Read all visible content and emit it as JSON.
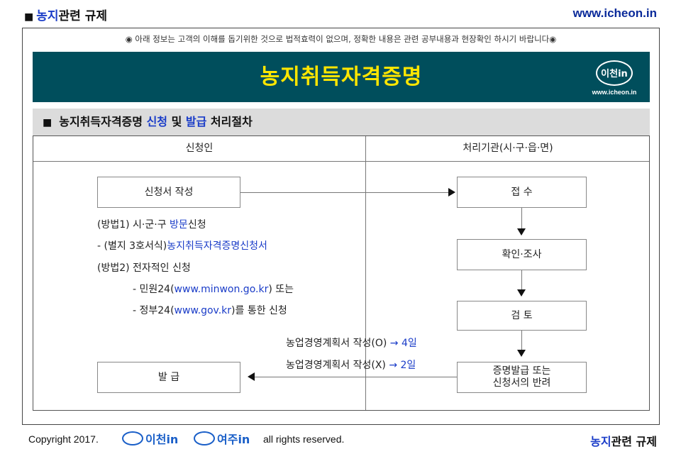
{
  "header": {
    "title_prefix": "■",
    "title_blue": "농지",
    "title_rest": "관련 규제",
    "url": "www.icheon.in"
  },
  "notice": "◉ 아래 정보는 고객의 이해를 돕기위한 것으로 법적효력이 없으며, 정확한 내용은 관련 공부내용과 현장확인 하시기 바랍니다◉",
  "banner": {
    "title": "농지취득자격증명",
    "logo_text": "이천in",
    "logo_url": "www.icheon.in",
    "bg_color": "#004e5c",
    "title_color": "#ffe600"
  },
  "section": {
    "bullet": "■",
    "part1": "농지취득자격증명 ",
    "part2": "신청",
    "part3": " 및 ",
    "part4": "발급",
    "part5": " 처리절차"
  },
  "table": {
    "col_left": "신청인",
    "col_right": "처리기관(시·구·읍·면)"
  },
  "flow": {
    "apply_box": "신청서 작성",
    "receive_box": "접  수",
    "check_box": "확인·조사",
    "review_box": "검  토",
    "issue_result_line1": "증명발급 또는",
    "issue_result_line2": "신청서의 반려",
    "issue_box": "발  급"
  },
  "methods": {
    "m1_prefix": "(방법1) 시·군·구 ",
    "m1_blue": "방문",
    "m1_suffix": "신청",
    "m1_sub_prefix": " - (별지 3호서식)",
    "m1_sub_blue": "농지취득자격증명신청서",
    "m2": "(방법2) 전자적인 신청",
    "m2_a_prefix": "- 민원24(",
    "m2_a_blue": "www.minwon.go.kr",
    "m2_a_suffix": ") 또는",
    "m2_b_prefix": "- 정부24(",
    "m2_b_blue": "www.gov.kr",
    "m2_b_suffix": ")를 통한 신청"
  },
  "durations": {
    "d1_prefix": "농업경영계획서 작성(O) ",
    "d1_blue": "→ 4일",
    "d2_prefix": "농업경영계획서 작성(X) ",
    "d2_blue": "→ 2일"
  },
  "footer": {
    "copyright": "Copyright 2017.",
    "logo1": "이천in",
    "logo2": "여주in",
    "rights": "all rights reserved.",
    "right_blue": "농지",
    "right_rest": "관련 규제"
  }
}
